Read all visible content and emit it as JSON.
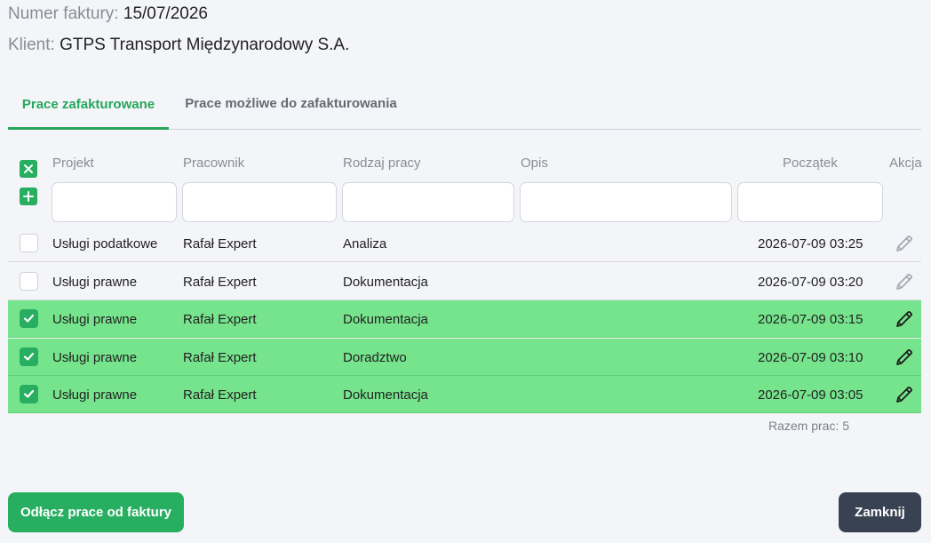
{
  "invoice": {
    "number_label": "Numer faktury:",
    "number": "15/07/2026"
  },
  "client": {
    "label": "Klient:",
    "name": "GTPS Transport Międzynarodowy S.A."
  },
  "tabs": [
    {
      "label": "Prace zafakturowane",
      "active": true
    },
    {
      "label": "Prace możliwe do zafakturowania",
      "active": false
    }
  ],
  "table": {
    "headers": {
      "project": "Projekt",
      "employee": "Pracownik",
      "work_type": "Rodzaj pracy",
      "description": "Opis",
      "start": "Początek",
      "action": "Akcja"
    },
    "filters": {
      "project": "",
      "employee": "",
      "work_type": "",
      "description": "",
      "start": ""
    },
    "rows": [
      {
        "project": "Usługi podatkowe",
        "employee": "Rafał Expert",
        "work_type": "Analiza",
        "description": "",
        "start": "2026-07-09 03:25",
        "selected": false
      },
      {
        "project": "Usługi prawne",
        "employee": "Rafał Expert",
        "work_type": "Dokumentacja",
        "description": "",
        "start": "2026-07-09 03:20",
        "selected": false
      },
      {
        "project": "Usługi prawne",
        "employee": "Rafał Expert",
        "work_type": "Dokumentacja",
        "description": "",
        "start": "2026-07-09 03:15",
        "selected": true
      },
      {
        "project": "Usługi prawne",
        "employee": "Rafał Expert",
        "work_type": "Doradztwo",
        "description": "",
        "start": "2026-07-09 03:10",
        "selected": true
      },
      {
        "project": "Usługi prawne",
        "employee": "Rafał Expert",
        "work_type": "Dokumentacja",
        "description": "",
        "start": "2026-07-09 03:05",
        "selected": true
      }
    ],
    "total": "Razem prac: 5"
  },
  "buttons": {
    "detach": "Odłącz prace od faktury",
    "close": "Zamknij"
  },
  "colors": {
    "accent": "#27ae60",
    "selected_row": "#76e48c",
    "close_button": "#394252"
  }
}
